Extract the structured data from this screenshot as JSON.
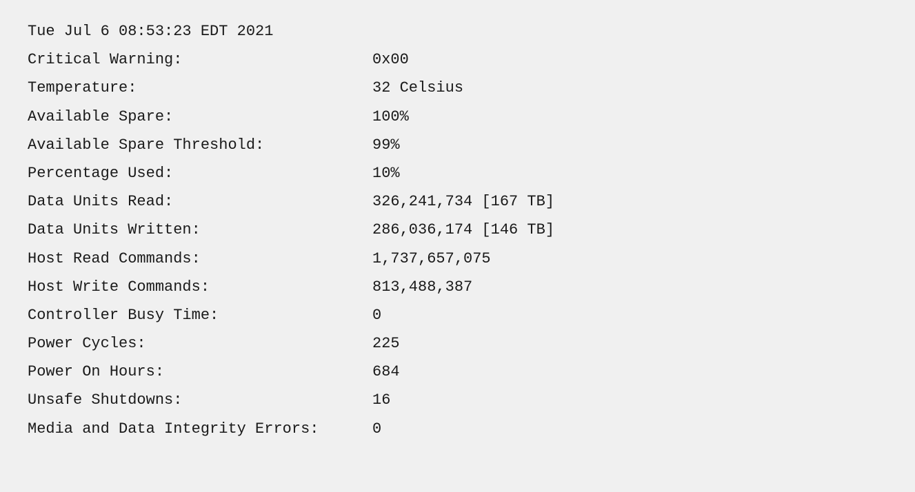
{
  "timestamp": "Tue Jul  6 08:53:23 EDT 2021",
  "rows": [
    {
      "label": "Critical Warning:",
      "value": "0x00"
    },
    {
      "label": "Temperature:",
      "value": "32 Celsius"
    },
    {
      "label": "Available Spare:",
      "value": "100%"
    },
    {
      "label": "Available Spare Threshold:",
      "value": "99%"
    },
    {
      "label": "Percentage Used:",
      "value": "10%"
    },
    {
      "label": "Data Units Read:",
      "value": "326,241,734 [167 TB]"
    },
    {
      "label": "Data Units Written:",
      "value": "286,036,174 [146 TB]"
    },
    {
      "label": "Host Read Commands:",
      "value": "1,737,657,075"
    },
    {
      "label": "Host Write Commands:",
      "value": "813,488,387"
    },
    {
      "label": "Controller Busy Time:",
      "value": "0"
    },
    {
      "label": "Power Cycles:",
      "value": "225"
    },
    {
      "label": "Power On Hours:",
      "value": "684"
    },
    {
      "label": "Unsafe Shutdowns:",
      "value": "16"
    },
    {
      "label": "Media and Data Integrity Errors:",
      "value": "0"
    }
  ]
}
